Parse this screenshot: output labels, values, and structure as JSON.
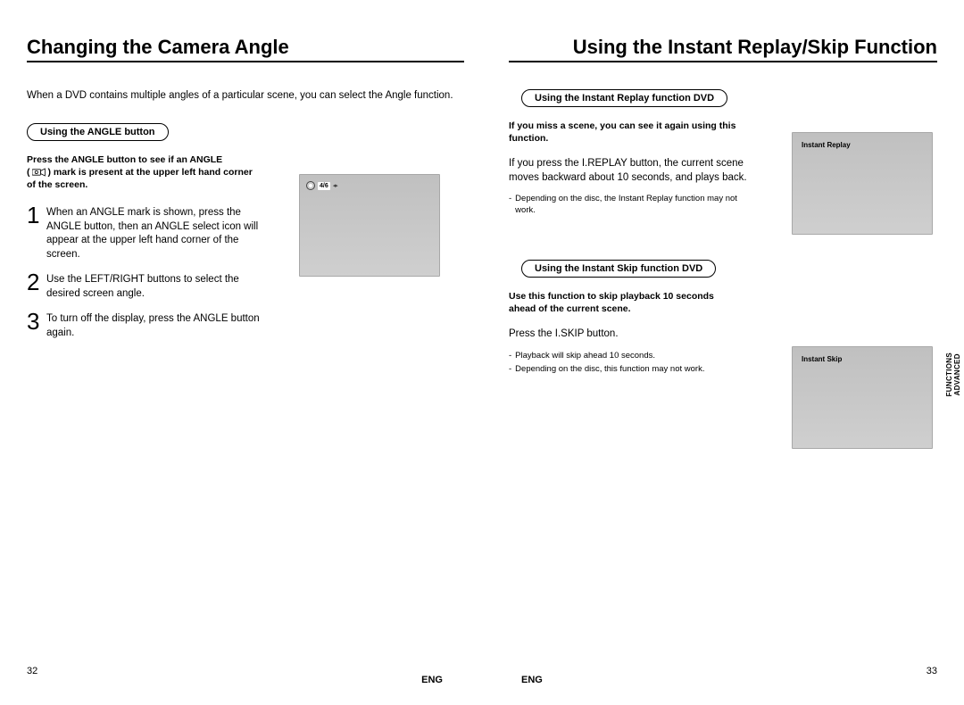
{
  "left": {
    "title": "Changing the Camera Angle",
    "intro": "When a DVD contains multiple angles of a particular scene, you can select the Angle function.",
    "pill": "Using the ANGLE button",
    "bold_note_a": "Press the ANGLE button to see if an ANGLE",
    "bold_note_b": ") mark is present at the upper left hand corner of the screen.",
    "angle_osd": "4/6",
    "steps": [
      {
        "n": "1",
        "t": "When an ANGLE mark is shown, press the ANGLE button, then an ANGLE select icon will appear at the upper left hand corner of the screen."
      },
      {
        "n": "2",
        "t": "Use the LEFT/RIGHT buttons to select the desired screen angle."
      },
      {
        "n": "3",
        "t": "To turn off the display, press the ANGLE button again."
      }
    ],
    "page_num": "32",
    "lang": "ENG"
  },
  "right": {
    "title": "Using the Instant Replay/Skip Function",
    "section1": {
      "pill": "Using the Instant Replay function DVD",
      "bold": "If you miss a scene, you can see it again using this function.",
      "body": "If you press the I.REPLAY button, the current scene moves backward about 10 seconds, and plays back.",
      "notes": [
        "Depending on the disc, the Instant Replay function may not work."
      ],
      "thumb_label": "Instant Replay"
    },
    "section2": {
      "pill": "Using the Instant Skip function DVD",
      "bold": "Use this function to skip playback 10 seconds ahead of the current scene.",
      "body": "Press the I.SKIP button.",
      "notes": [
        "Playback will skip ahead 10 seconds.",
        "Depending on the disc, this function may not work."
      ],
      "thumb_label": "Instant Skip"
    },
    "side_tab_a": "ADVANCED",
    "side_tab_b": "FUNCTIONS",
    "page_num": "33",
    "lang": "ENG"
  }
}
